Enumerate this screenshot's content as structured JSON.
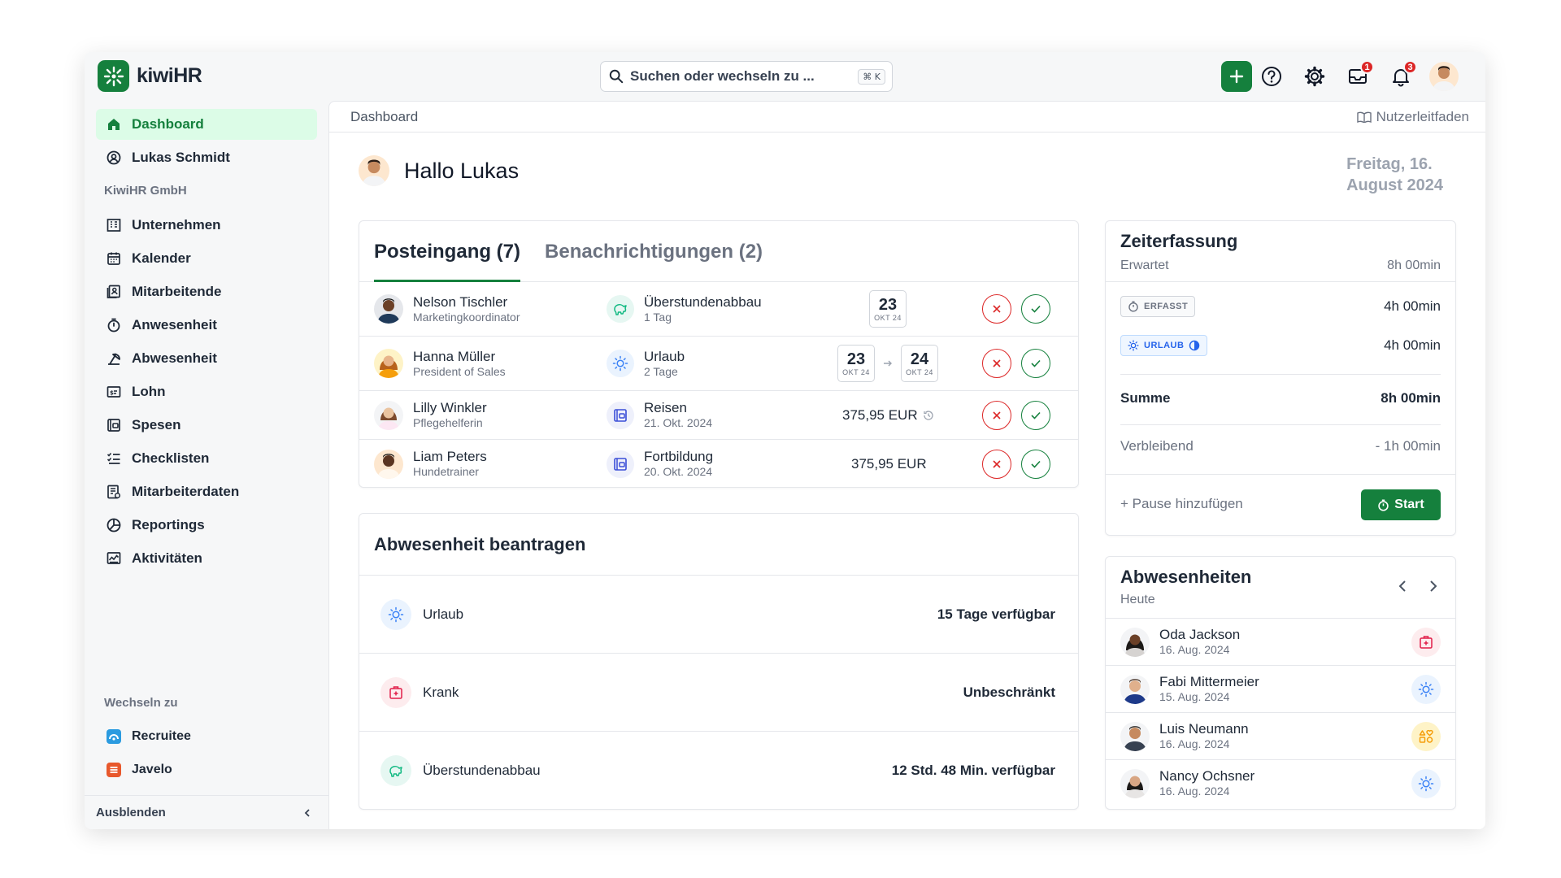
{
  "app": {
    "name": "kiwiHR"
  },
  "search": {
    "placeholder": "Suchen oder wechseln zu ...",
    "shortcut": "⌘ K"
  },
  "topbar": {
    "inbox_badge": "1",
    "bell_badge": "3"
  },
  "sidebar": {
    "items": [
      {
        "label": "Dashboard",
        "icon": "home-icon"
      },
      {
        "label": "Lukas Schmidt",
        "icon": "user-circle-icon"
      }
    ],
    "company": "KiwiHR GmbH",
    "company_items": [
      {
        "label": "Unternehmen",
        "icon": "building-icon"
      },
      {
        "label": "Kalender",
        "icon": "calendar-icon"
      },
      {
        "label": "Mitarbeitende",
        "icon": "contacts-icon"
      },
      {
        "label": "Anwesenheit",
        "icon": "stopwatch-icon"
      },
      {
        "label": "Abwesenheit",
        "icon": "absence-icon"
      },
      {
        "label": "Lohn",
        "icon": "payroll-icon"
      },
      {
        "label": "Spesen",
        "icon": "expense-icon"
      },
      {
        "label": "Checklisten",
        "icon": "checklist-icon"
      },
      {
        "label": "Mitarbeiterdaten",
        "icon": "employee-data-icon"
      },
      {
        "label": "Reportings",
        "icon": "pie-chart-icon"
      },
      {
        "label": "Aktivitäten",
        "icon": "activity-icon"
      }
    ],
    "switch_label": "Wechseln zu",
    "switch_items": [
      {
        "label": "Recruitee"
      },
      {
        "label": "Javelo"
      }
    ],
    "hide_label": "Ausblenden"
  },
  "breadcrumb": "Dashboard",
  "guide": "Nutzerleitfaden",
  "greeting": "Hallo Lukas",
  "date_line1": "Freitag, 16.",
  "date_line2": "August 2024",
  "inbox": {
    "tabs": [
      "Posteingang (7)",
      "Benachrichtigungen (2)"
    ],
    "rows": [
      {
        "name": "Nelson Tischler",
        "role": "Marketingkoordinator",
        "type": "Überstundenabbau",
        "detail": "1 Tag",
        "d1": "23",
        "m1": "OKT 24"
      },
      {
        "name": "Hanna Müller",
        "role": "President of Sales",
        "type": "Urlaub",
        "detail": "2 Tage",
        "d1": "23",
        "m1": "OKT 24",
        "d2": "24",
        "m2": "OKT 24"
      },
      {
        "name": "Lilly Winkler",
        "role": "Pflegehelferin",
        "type": "Reisen",
        "detail": "21. Okt. 2024",
        "amount": "375,95 EUR"
      },
      {
        "name": "Liam Peters",
        "role": "Hundetrainer",
        "type": "Fortbildung",
        "detail": "20. Okt. 2024",
        "amount": "375,95 EUR"
      }
    ]
  },
  "absence_request": {
    "title": "Abwesenheit beantragen",
    "rows": [
      {
        "label": "Urlaub",
        "value": "15 Tage verfügbar"
      },
      {
        "label": "Krank",
        "value": "Unbeschränkt"
      },
      {
        "label": "Überstundenabbau",
        "value": "12 Std. 48 Min. verfügbar"
      }
    ]
  },
  "time_tracking": {
    "title": "Zeiterfassung",
    "expected_label": "Erwartet",
    "expected_value": "8h 00min",
    "recorded_tag": "ERFASST",
    "recorded_value": "4h 00min",
    "vacation_tag": "URLAUB",
    "vacation_value": "4h 00min",
    "sum_label": "Summe",
    "sum_value": "8h 00min",
    "remaining_label": "Verbleibend",
    "remaining_value": "- 1h 00min",
    "pause_label": "+ Pause hinzufügen",
    "start_label": "Start"
  },
  "absences": {
    "title": "Abwesenheiten",
    "subtitle": "Heute",
    "rows": [
      {
        "name": "Oda Jackson",
        "date": "16. Aug. 2024",
        "icon": "sick-icon"
      },
      {
        "name": "Fabi Mittermeier",
        "date": "15. Aug. 2024",
        "icon": "sun-icon"
      },
      {
        "name": "Luis Neumann",
        "date": "16. Aug. 2024",
        "icon": "shapes-icon"
      },
      {
        "name": "Nancy Ochsner",
        "date": "16. Aug. 2024",
        "icon": "sun-icon"
      }
    ]
  },
  "colors": {
    "accent": "#15803d",
    "danger": "#dc2626",
    "sky": "#3b82f6"
  }
}
